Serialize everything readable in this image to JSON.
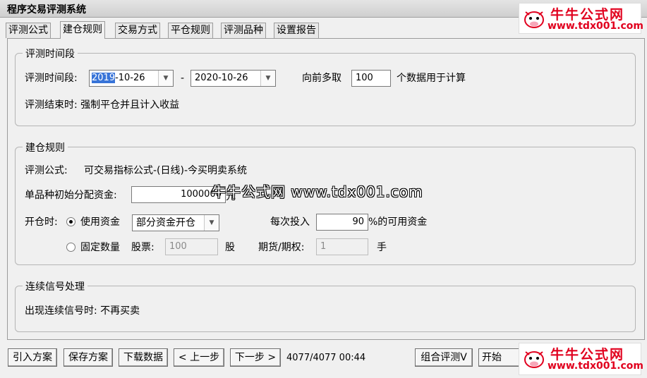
{
  "window": {
    "title": "程序交易评测系统"
  },
  "tabs": [
    {
      "label": "评测公式"
    },
    {
      "label": "建仓规则"
    },
    {
      "label": "交易方式"
    },
    {
      "label": "平仓规则"
    },
    {
      "label": "评测品种"
    },
    {
      "label": "设置报告"
    }
  ],
  "active_tab": "建仓规则",
  "period": {
    "group_title": "评测时间段",
    "label": "评测时间段:",
    "start_year_selected": "2019",
    "start_rest": "-10-26",
    "end_date": "2020-10-26",
    "dash": "-",
    "lookback_label": "向前多取",
    "lookback_value": "100",
    "lookback_suffix": "个数据用于计算",
    "end_note": "评测结束时: 强制平仓并且计入收益"
  },
  "open_rules": {
    "group_title": "建仓规则",
    "formula_label": "评测公式:",
    "formula_value": "可交易指标公式-(日线)-今买明卖系统",
    "capital_label": "单品种初始分配资金:",
    "capital_value": "1000000",
    "capital_unit": "元",
    "open_label": "开仓时:",
    "use_capital_label": "使用资金",
    "capital_mode": "部分资金开仓",
    "each_invest_label": "每次投入",
    "each_invest_value": "90",
    "each_invest_suffix": "%的可用资金",
    "fixed_qty_label": "固定数量",
    "stock_label": "股票:",
    "stock_value": "100",
    "stock_unit": "股",
    "futures_label": "期货/期权:",
    "futures_value": "1",
    "futures_unit": "手",
    "selected_mode": "使用资金"
  },
  "signals": {
    "group_title": "连续信号处理",
    "text": "出现连续信号时: 不再买卖"
  },
  "bottom": {
    "import": "引入方案",
    "save": "保存方案",
    "download": "下载数据",
    "prev": "< 上一步",
    "next": "下一步 >",
    "status": "4077/4077 00:44",
    "combo_eval": "组合评测V",
    "start": "开始"
  },
  "watermark": {
    "logo_cn": "牛牛公式网",
    "logo_url": "www.tdx001.com",
    "center_text": "牛牛公式网 www.tdx001.com"
  },
  "colors": {
    "selection": "#3874d8",
    "brand_red": "#e1001e"
  }
}
